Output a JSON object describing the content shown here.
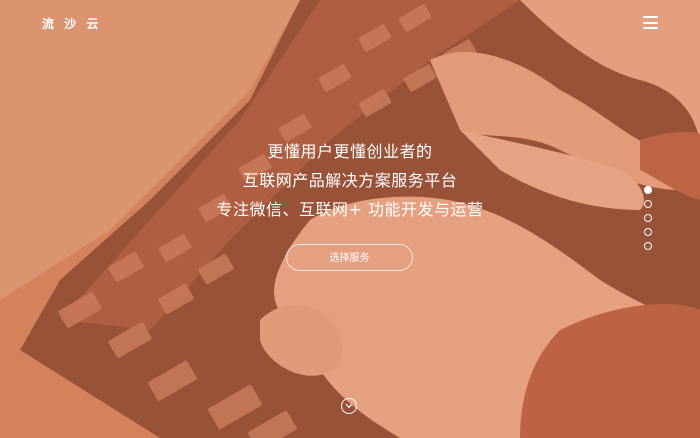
{
  "header": {
    "logo_text": "流 沙 云",
    "menu_icon": "hamburger-menu-icon"
  },
  "hero": {
    "line1": "更懂用户更懂创业者的",
    "line2": "互联网产品解决方案服务平台",
    "line3": "专注微信、互联网+ 功能开发与运营",
    "cta_label": "选择服务",
    "tint_color": "#c9724f"
  },
  "pagination": {
    "count": 5,
    "active_index": 0
  },
  "scroll": {
    "icon": "chevron-down-icon"
  }
}
